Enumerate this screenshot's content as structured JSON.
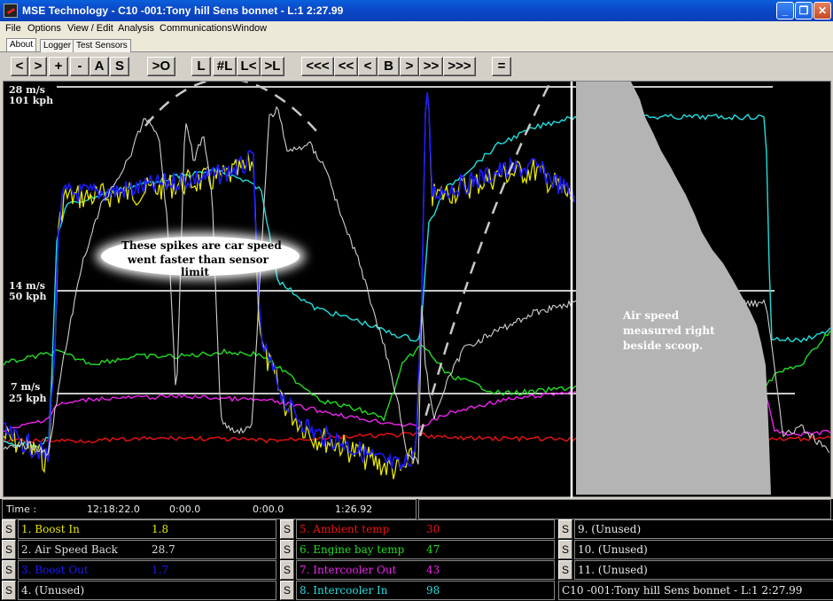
{
  "window": {
    "title": "MSE Technology - C10 -001:Tony hill Sens bonnet - L:1 2:27.99",
    "controls": [
      "_",
      "❐",
      "✕"
    ]
  },
  "menu": [
    "File",
    "Options",
    "View / Edit",
    "Analysis",
    "Communications",
    "Window"
  ],
  "tabs": [
    "About",
    "Logger",
    "Test Sensors"
  ],
  "toolbar": {
    "buttons": [
      "<",
      ">",
      "+",
      "-",
      "A",
      "S",
      ">O",
      "L",
      "#L",
      "L<",
      ">L",
      "<<<",
      "<<",
      "<",
      "B",
      ">",
      ">>",
      ">>>",
      "="
    ]
  },
  "chart": {
    "y_labels": [
      {
        "ms": "28 m/s",
        "kph": "101 kph"
      },
      {
        "ms": "14 m/s",
        "kph": "50 kph"
      },
      {
        "ms": "7 m/s",
        "kph": "25 kph"
      }
    ],
    "annotation_spikes": [
      "These spikes are car speed",
      "went faster than sensor",
      "limit"
    ],
    "annotation_scoop": [
      "Air speed",
      "measured right",
      "beside scoop."
    ]
  },
  "time_row": {
    "label": "Time :",
    "values": [
      "12:18:22.0",
      "0:00.0",
      "0:00.0",
      "1:26.92"
    ]
  },
  "channels": [
    {
      "s": "S",
      "name": "1. Boost In",
      "value": "1.8",
      "color": "#e6e600"
    },
    {
      "s": "S",
      "name": "5. Ambient temp",
      "value": "30",
      "color": "#ee1111"
    },
    {
      "s": "S",
      "name": "9. (Unused)",
      "value": "",
      "color": "#e8e8e8"
    },
    {
      "s": "S",
      "name": "2. Air Speed Back",
      "value": "28.7",
      "color": "#dcdcdc"
    },
    {
      "s": "S",
      "name": "6. Engine bay temp",
      "value": "47",
      "color": "#22dd22"
    },
    {
      "s": "S",
      "name": "10. (Unused)",
      "value": "",
      "color": "#e8e8e8"
    },
    {
      "s": "S",
      "name": "3. Boost Out",
      "value": "1.7",
      "color": "#1a1aff"
    },
    {
      "s": "S",
      "name": "7. Intercooler Out",
      "value": "43",
      "color": "#ee22ee"
    },
    {
      "s": "S",
      "name": "11. (Unused)",
      "value": "",
      "color": "#e8e8e8"
    },
    {
      "s": "S",
      "name": "4. (Unused)",
      "value": "",
      "color": "#e8e8e8"
    },
    {
      "s": "S",
      "name": "8. Intercooler In",
      "value": "98",
      "color": "#22dddd"
    },
    {
      "s": "",
      "name": "C10 -001:Tony hill Sens bonnet - L:1 2:27.99",
      "value": "",
      "color": "#e8e8e8"
    }
  ]
}
